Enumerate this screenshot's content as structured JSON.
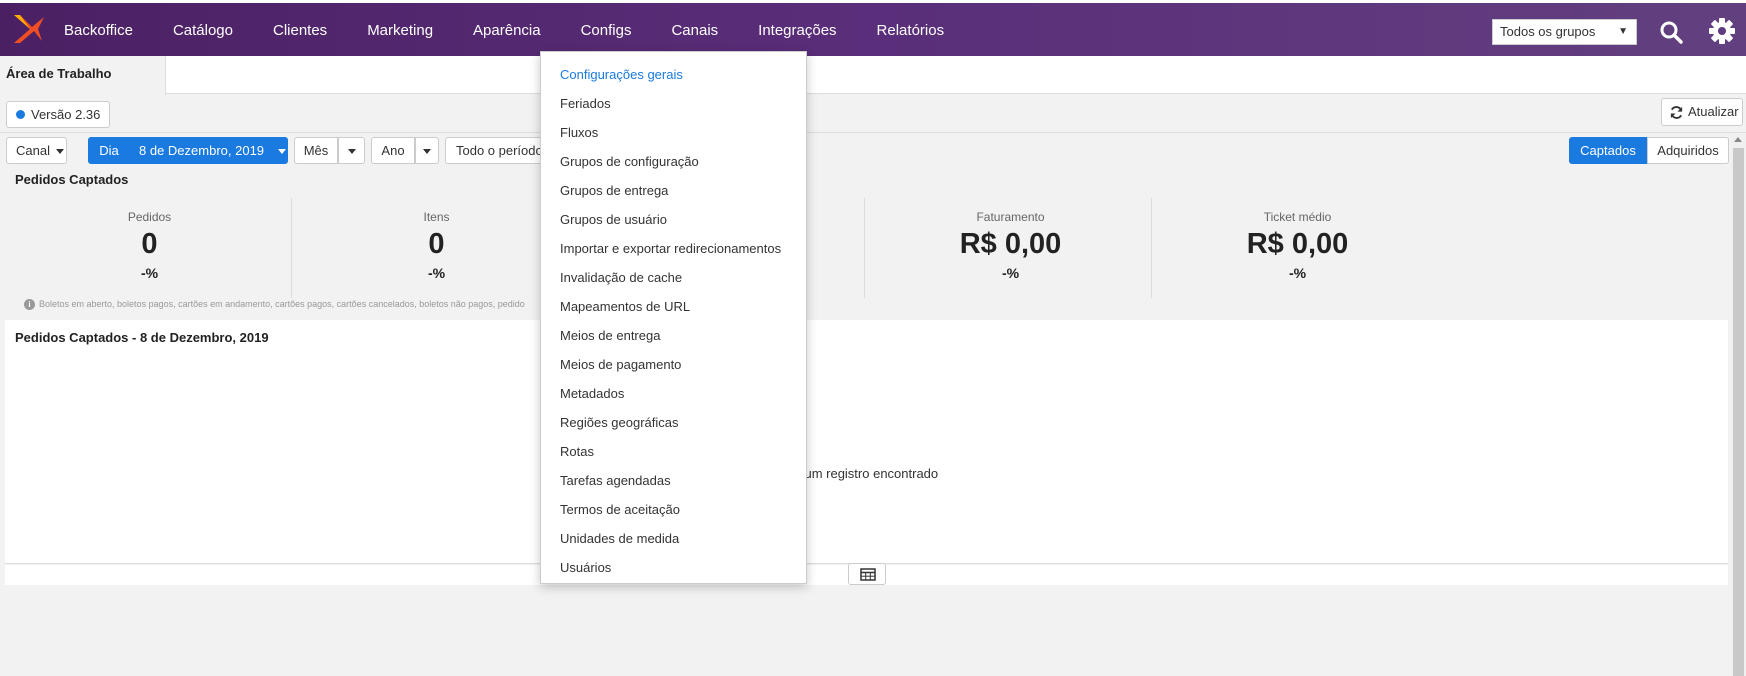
{
  "nav": {
    "items": [
      "Backoffice",
      "Catálogo",
      "Clientes",
      "Marketing",
      "Aparência",
      "Configs",
      "Canais",
      "Integrações",
      "Relatórios"
    ],
    "group_select": "Todos os grupos"
  },
  "tabs": {
    "active": "Área de Trabalho"
  },
  "version": "Versão 2.36",
  "refresh_label": "Atualizar",
  "filters": {
    "canal": "Canal",
    "dia": "Dia",
    "date": "8 de Dezembro, 2019",
    "mes": "Mês",
    "ano": "Ano",
    "periodo": "Todo o período",
    "captados": "Captados",
    "adquiridos": "Adquiridos"
  },
  "summary": {
    "title": "Pedidos Captados",
    "metrics": [
      {
        "label": "Pedidos",
        "value": "0",
        "change": "-%"
      },
      {
        "label": "Itens",
        "value": "0",
        "change": "-%"
      },
      {
        "label": "Faturamento",
        "value": "R$ 0,00",
        "change": "-%"
      },
      {
        "label": "Ticket médio",
        "value": "R$ 0,00",
        "change": "-%"
      }
    ],
    "note": "Boletos em aberto, boletos pagos, cartões em andamento, cartões pagos, cartões cancelados, boletos não pagos, pedido"
  },
  "chart_panel": {
    "title": "Pedidos Captados - 8 de Dezembro, 2019",
    "empty_message": "nhum registro encontrado"
  },
  "dropdown": {
    "items": [
      "Configurações gerais",
      "Feriados",
      "Fluxos",
      "Grupos de configuração",
      "Grupos de entrega",
      "Grupos de usuário",
      "Importar e exportar redirecionamentos",
      "Invalidação de cache",
      "Mapeamentos de URL",
      "Meios de entrega",
      "Meios de pagamento",
      "Metadados",
      "Regiões geográficas",
      "Rotas",
      "Tarefas agendadas",
      "Termos de aceitação",
      "Unidades de medida",
      "Usuários"
    ],
    "active_index": 0
  },
  "colors": {
    "nav_bg": "#5a2e7a",
    "accent": "#1a7ae0",
    "logo_orange": "#f04e23"
  }
}
